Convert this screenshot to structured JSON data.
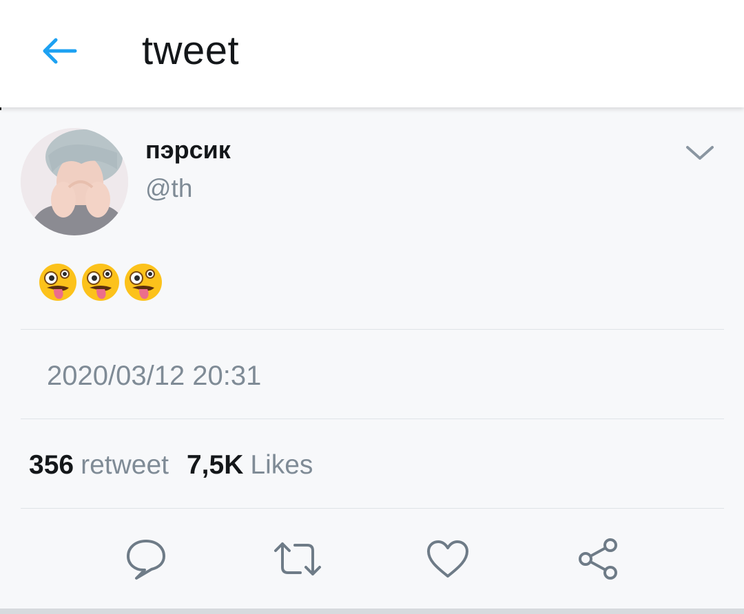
{
  "header": {
    "title": "tweet",
    "back_icon": "arrow-left-icon",
    "accent_color": "#1da1f2"
  },
  "tweet": {
    "author": {
      "name": "пэрсик",
      "handle": "@th",
      "avatar_icon": "profile-photo"
    },
    "text": "🤪🤪🤪",
    "emojis": [
      "zany-face",
      "zany-face",
      "zany-face"
    ],
    "timestamp": "2020/03/12 20:31",
    "stats": {
      "retweets_count": "356",
      "retweets_label": "retweet",
      "likes_count": "7,5K",
      "likes_label": "Likes"
    },
    "actions": [
      {
        "name": "reply",
        "icon": "speech-bubble-icon"
      },
      {
        "name": "retweet",
        "icon": "retweet-arrows-icon"
      },
      {
        "name": "like",
        "icon": "heart-icon"
      },
      {
        "name": "share",
        "icon": "share-nodes-icon"
      }
    ]
  },
  "colors": {
    "text_primary": "#14171a",
    "text_secondary": "#7f8b96",
    "icon_gray": "#6e7b87",
    "background": "#f7f8fa"
  }
}
